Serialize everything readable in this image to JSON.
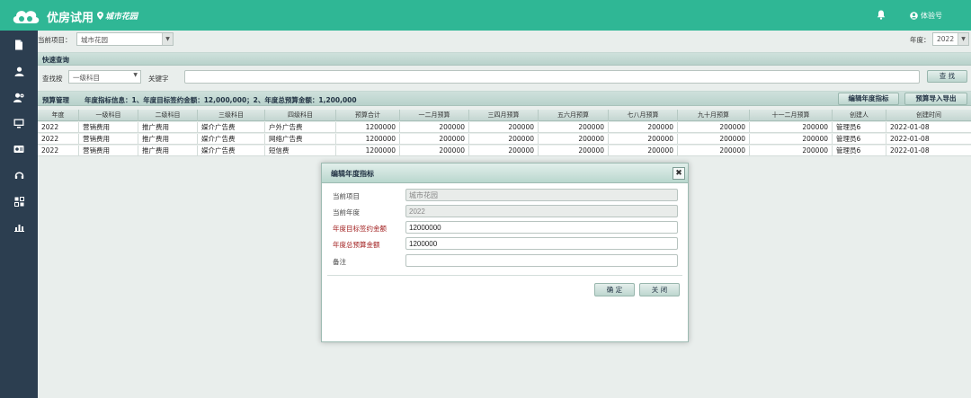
{
  "header": {
    "app_title": "优房试用",
    "location": "城市花园",
    "user": "体验号"
  },
  "sidebar": {
    "icons": [
      "document-icon",
      "user-icon",
      "user-settings-icon",
      "monitor-icon",
      "card-icon",
      "headset-icon",
      "apps-icon",
      "bar-chart-icon"
    ]
  },
  "filters": {
    "project_label": "当前项目：",
    "project_value": "城市花园",
    "year_label": "年度：",
    "year_value": "2022"
  },
  "quick_search": {
    "title": "快速查询",
    "find_by_label": "查找按",
    "find_by_value": "一级科目",
    "keyword_label": "关键字",
    "keyword_value": "",
    "search_button": "查 找"
  },
  "budget": {
    "title": "预算管理",
    "info": "年度指标信息：1、年度目标签约金额：12,000,000；2、年度总预算金额：1,200,000",
    "edit_button": "编辑年度指标",
    "import_button": "预算导入导出"
  },
  "table": {
    "columns": [
      "年度",
      "一级科目",
      "二级科目",
      "三级科目",
      "四级科目",
      "预算合计",
      "一二月预算",
      "三四月预算",
      "五六月预算",
      "七八月预算",
      "九十月预算",
      "十一二月预算",
      "创建人",
      "创建时间"
    ],
    "rows": [
      [
        "2022",
        "营销费用",
        "推广费用",
        "媒介广告费",
        "户外广告费",
        "1200000",
        "200000",
        "200000",
        "200000",
        "200000",
        "200000",
        "200000",
        "管理员6",
        "2022-01-08"
      ],
      [
        "2022",
        "营销费用",
        "推广费用",
        "媒介广告费",
        "网络广告费",
        "1200000",
        "200000",
        "200000",
        "200000",
        "200000",
        "200000",
        "200000",
        "管理员6",
        "2022-01-08"
      ],
      [
        "2022",
        "营销费用",
        "推广费用",
        "媒介广告费",
        "短信费",
        "1200000",
        "200000",
        "200000",
        "200000",
        "200000",
        "200000",
        "200000",
        "管理员6",
        "2022-01-08"
      ]
    ]
  },
  "dialog": {
    "title": "编辑年度指标",
    "close": "✖",
    "fields": {
      "project_label": "当前项目",
      "project_value": "城市花园",
      "year_label": "当前年度",
      "year_value": "2022",
      "target_label": "年度目标签约金额",
      "target_value": "12000000",
      "budget_label": "年度总预算金额",
      "budget_value": "1200000",
      "remark_label": "备注",
      "remark_value": ""
    },
    "confirm": "确 定",
    "close_button": "关 闭"
  }
}
